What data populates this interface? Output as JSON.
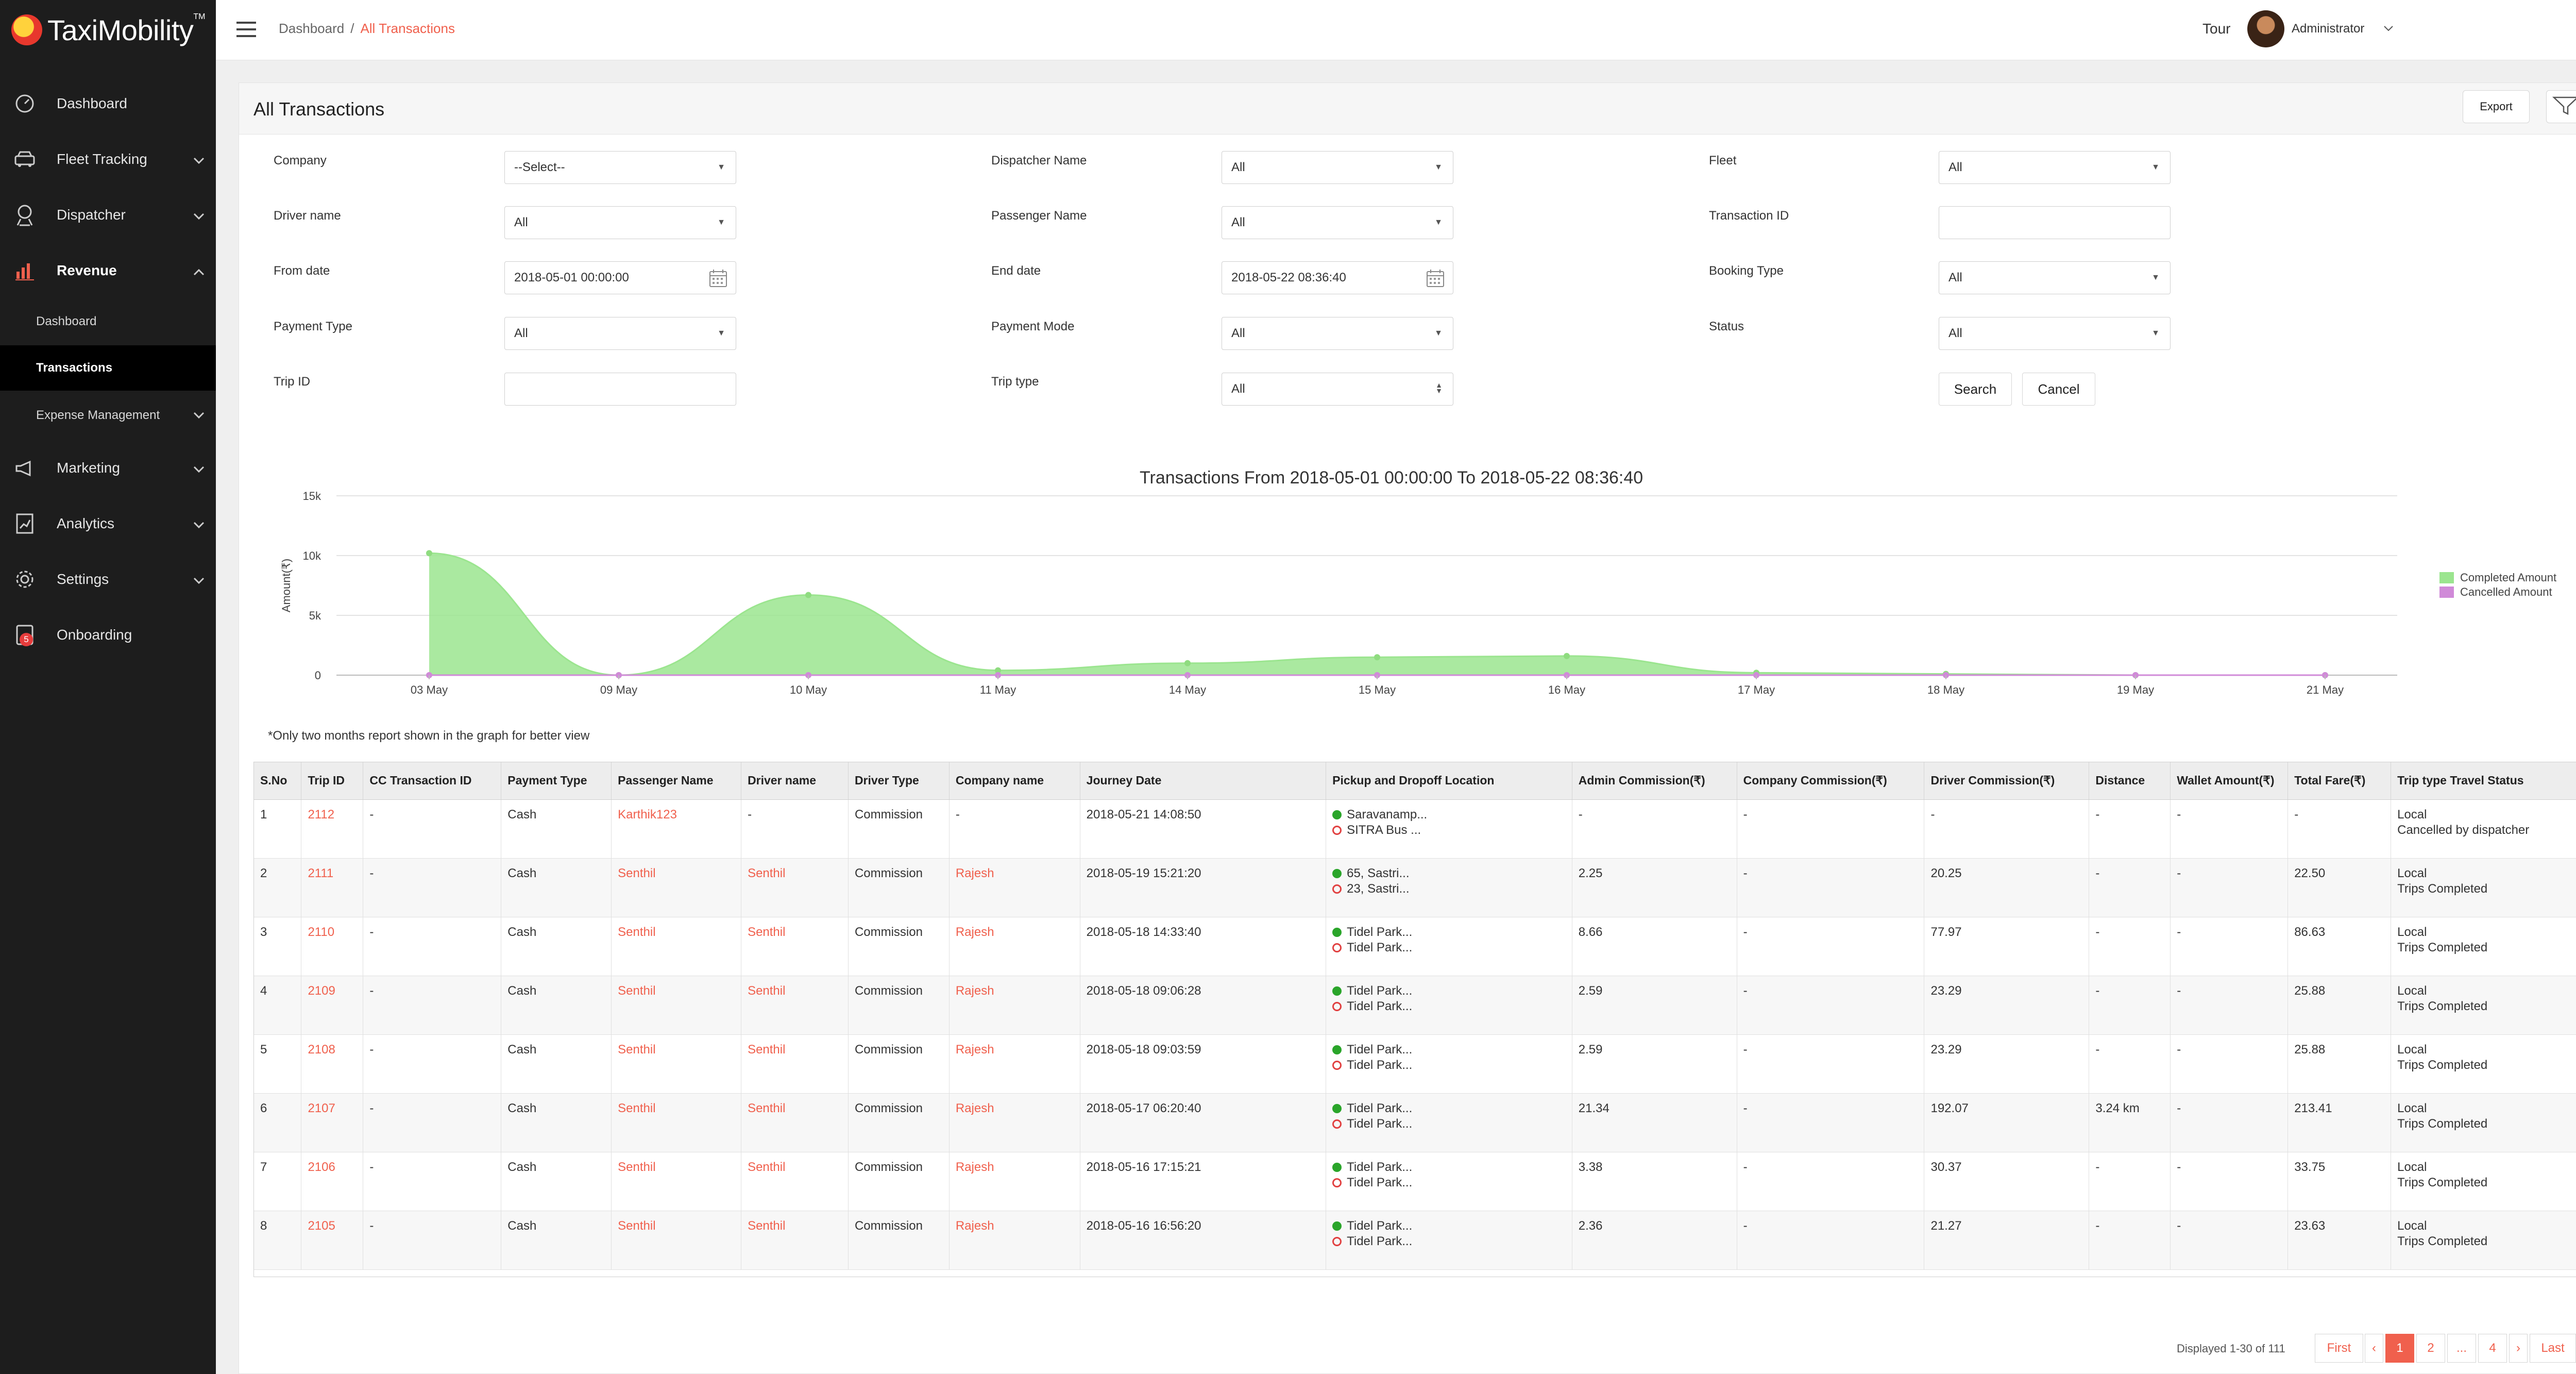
{
  "app": {
    "logo_text": "TaxiMobility",
    "logo_tm": "TM"
  },
  "sidebar": {
    "items": [
      {
        "label": "Dashboard",
        "icon": "speedometer-icon"
      },
      {
        "label": "Fleet Tracking",
        "icon": "car-icon"
      },
      {
        "label": "Dispatcher",
        "icon": "dispatcher-icon"
      },
      {
        "label": "Revenue",
        "icon": "bar-chart-icon"
      },
      {
        "label": "Marketing",
        "icon": "megaphone-icon"
      },
      {
        "label": "Analytics",
        "icon": "analytics-icon"
      },
      {
        "label": "Settings",
        "icon": "gear-icon"
      },
      {
        "label": "Onboarding",
        "icon": "onboarding-icon",
        "badge": "5"
      }
    ],
    "revenue_sub": [
      {
        "label": "Dashboard"
      },
      {
        "label": "Transactions"
      },
      {
        "label": "Expense Management"
      }
    ]
  },
  "topbar": {
    "crumb_root": "Dashboard",
    "crumb_sep": "/",
    "crumb_current": "All Transactions",
    "tour": "Tour",
    "user": "Administrator"
  },
  "page": {
    "title": "All Transactions",
    "export_label": "Export"
  },
  "filters": {
    "company": {
      "label": "Company",
      "value": "--Select--"
    },
    "dispatcher": {
      "label": "Dispatcher Name",
      "value": "All"
    },
    "fleet": {
      "label": "Fleet",
      "value": "All"
    },
    "driver": {
      "label": "Driver name",
      "value": "All"
    },
    "passenger": {
      "label": "Passenger Name",
      "value": "All"
    },
    "transaction_id": {
      "label": "Transaction ID",
      "value": ""
    },
    "from_date": {
      "label": "From date",
      "value": "2018-05-01 00:00:00"
    },
    "end_date": {
      "label": "End date",
      "value": "2018-05-22 08:36:40"
    },
    "booking_type": {
      "label": "Booking Type",
      "value": "All"
    },
    "payment_type": {
      "label": "Payment Type",
      "value": "All"
    },
    "payment_mode": {
      "label": "Payment Mode",
      "value": "All"
    },
    "status": {
      "label": "Status",
      "value": "All"
    },
    "trip_id": {
      "label": "Trip ID",
      "value": ""
    },
    "trip_type": {
      "label": "Trip type",
      "value": "All"
    },
    "search_label": "Search",
    "cancel_label": "Cancel"
  },
  "chart_data": {
    "type": "area",
    "title": "Transactions From 2018-05-01 00:00:00 To 2018-05-22 08:36:40",
    "ylabel": "Amount(₹)",
    "xlabel": "",
    "ylim": [
      0,
      15000
    ],
    "yticks": [
      "0",
      "5k",
      "10k",
      "15k"
    ],
    "yticks_values": [
      0,
      5000,
      10000,
      15000
    ],
    "categories": [
      "03 May",
      "09 May",
      "10 May",
      "11 May",
      "14 May",
      "15 May",
      "16 May",
      "17 May",
      "18 May",
      "19 May",
      "21 May"
    ],
    "series": [
      {
        "name": "Completed Amount",
        "color": "#9be58f",
        "values": [
          10200,
          0,
          6700,
          400,
          1000,
          1500,
          1600,
          200,
          100,
          0,
          0
        ]
      },
      {
        "name": "Cancelled Amount",
        "color": "#d08ad8",
        "values": [
          0,
          0,
          0,
          0,
          0,
          0,
          0,
          0,
          0,
          0,
          0
        ]
      }
    ],
    "grid": true,
    "legend": "right"
  },
  "note": "*Only two months report shown in the graph for better view",
  "table": {
    "headers": [
      "S.No",
      "Trip ID",
      "CC Transaction ID",
      "Payment Type",
      "Passenger Name",
      "Driver name",
      "Driver Type",
      "Company name",
      "Journey Date",
      "Pickup and Dropoff Location",
      "Admin Commission(₹)",
      "Company Commission(₹)",
      "Driver Commission(₹)",
      "Distance",
      "Wallet Amount(₹)",
      "Total Fare(₹)",
      "Trip type Travel Status"
    ],
    "rows": [
      {
        "sno": "1",
        "trip": "2112",
        "cc": "-",
        "pay": "Cash",
        "passenger": "Karthik123",
        "driver": "-",
        "dtype": "Commission",
        "company": "-",
        "date": "2018-05-21 14:08:50",
        "pickup": "Saravanamp...",
        "drop": "SITRA Bus ...",
        "admin": "-",
        "ccom": "-",
        "dcom": "-",
        "dist": "-",
        "wallet": "-",
        "fare": "-",
        "ttype": "Local",
        "tstatus": "Cancelled by dispatcher"
      },
      {
        "sno": "2",
        "trip": "2111",
        "cc": "-",
        "pay": "Cash",
        "passenger": "Senthil",
        "driver": "Senthil",
        "dtype": "Commission",
        "company": "Rajesh",
        "date": "2018-05-19 15:21:20",
        "pickup": "65, Sastri...",
        "drop": "23, Sastri...",
        "admin": "2.25",
        "ccom": "-",
        "dcom": "20.25",
        "dist": "-",
        "wallet": "-",
        "fare": "22.50",
        "ttype": "Local",
        "tstatus": "Trips Completed"
      },
      {
        "sno": "3",
        "trip": "2110",
        "cc": "-",
        "pay": "Cash",
        "passenger": "Senthil",
        "driver": "Senthil",
        "dtype": "Commission",
        "company": "Rajesh",
        "date": "2018-05-18 14:33:40",
        "pickup": "Tidel Park...",
        "drop": "Tidel Park...",
        "admin": "8.66",
        "ccom": "-",
        "dcom": "77.97",
        "dist": "-",
        "wallet": "-",
        "fare": "86.63",
        "ttype": "Local",
        "tstatus": "Trips Completed"
      },
      {
        "sno": "4",
        "trip": "2109",
        "cc": "-",
        "pay": "Cash",
        "passenger": "Senthil",
        "driver": "Senthil",
        "dtype": "Commission",
        "company": "Rajesh",
        "date": "2018-05-18 09:06:28",
        "pickup": "Tidel Park...",
        "drop": "Tidel Park...",
        "admin": "2.59",
        "ccom": "-",
        "dcom": "23.29",
        "dist": "-",
        "wallet": "-",
        "fare": "25.88",
        "ttype": "Local",
        "tstatus": "Trips Completed"
      },
      {
        "sno": "5",
        "trip": "2108",
        "cc": "-",
        "pay": "Cash",
        "passenger": "Senthil",
        "driver": "Senthil",
        "dtype": "Commission",
        "company": "Rajesh",
        "date": "2018-05-18 09:03:59",
        "pickup": "Tidel Park...",
        "drop": "Tidel Park...",
        "admin": "2.59",
        "ccom": "-",
        "dcom": "23.29",
        "dist": "-",
        "wallet": "-",
        "fare": "25.88",
        "ttype": "Local",
        "tstatus": "Trips Completed"
      },
      {
        "sno": "6",
        "trip": "2107",
        "cc": "-",
        "pay": "Cash",
        "passenger": "Senthil",
        "driver": "Senthil",
        "dtype": "Commission",
        "company": "Rajesh",
        "date": "2018-05-17 06:20:40",
        "pickup": "Tidel Park...",
        "drop": "Tidel Park...",
        "admin": "21.34",
        "ccom": "-",
        "dcom": "192.07",
        "dist": "3.24 km",
        "wallet": "-",
        "fare": "213.41",
        "ttype": "Local",
        "tstatus": "Trips Completed"
      },
      {
        "sno": "7",
        "trip": "2106",
        "cc": "-",
        "pay": "Cash",
        "passenger": "Senthil",
        "driver": "Senthil",
        "dtype": "Commission",
        "company": "Rajesh",
        "date": "2018-05-16 17:15:21",
        "pickup": "Tidel Park...",
        "drop": "Tidel Park...",
        "admin": "3.38",
        "ccom": "-",
        "dcom": "30.37",
        "dist": "-",
        "wallet": "-",
        "fare": "33.75",
        "ttype": "Local",
        "tstatus": "Trips Completed"
      },
      {
        "sno": "8",
        "trip": "2105",
        "cc": "-",
        "pay": "Cash",
        "passenger": "Senthil",
        "driver": "Senthil",
        "dtype": "Commission",
        "company": "Rajesh",
        "date": "2018-05-16 16:56:20",
        "pickup": "Tidel Park...",
        "drop": "Tidel Park...",
        "admin": "2.36",
        "ccom": "-",
        "dcom": "21.27",
        "dist": "-",
        "wallet": "-",
        "fare": "23.63",
        "ttype": "Local",
        "tstatus": "Trips Completed"
      }
    ]
  },
  "pagination": {
    "info": "Displayed 1-30 of 111",
    "first": "First",
    "prev": "‹",
    "pages": [
      "1",
      "2",
      "...",
      "4"
    ],
    "current": "1",
    "next": "›",
    "last": "Last"
  },
  "colors": {
    "accent": "#f0604d",
    "sidebar_bg": "#1d1d1d",
    "completed": "#9be58f",
    "cancelled": "#d08ad8"
  }
}
